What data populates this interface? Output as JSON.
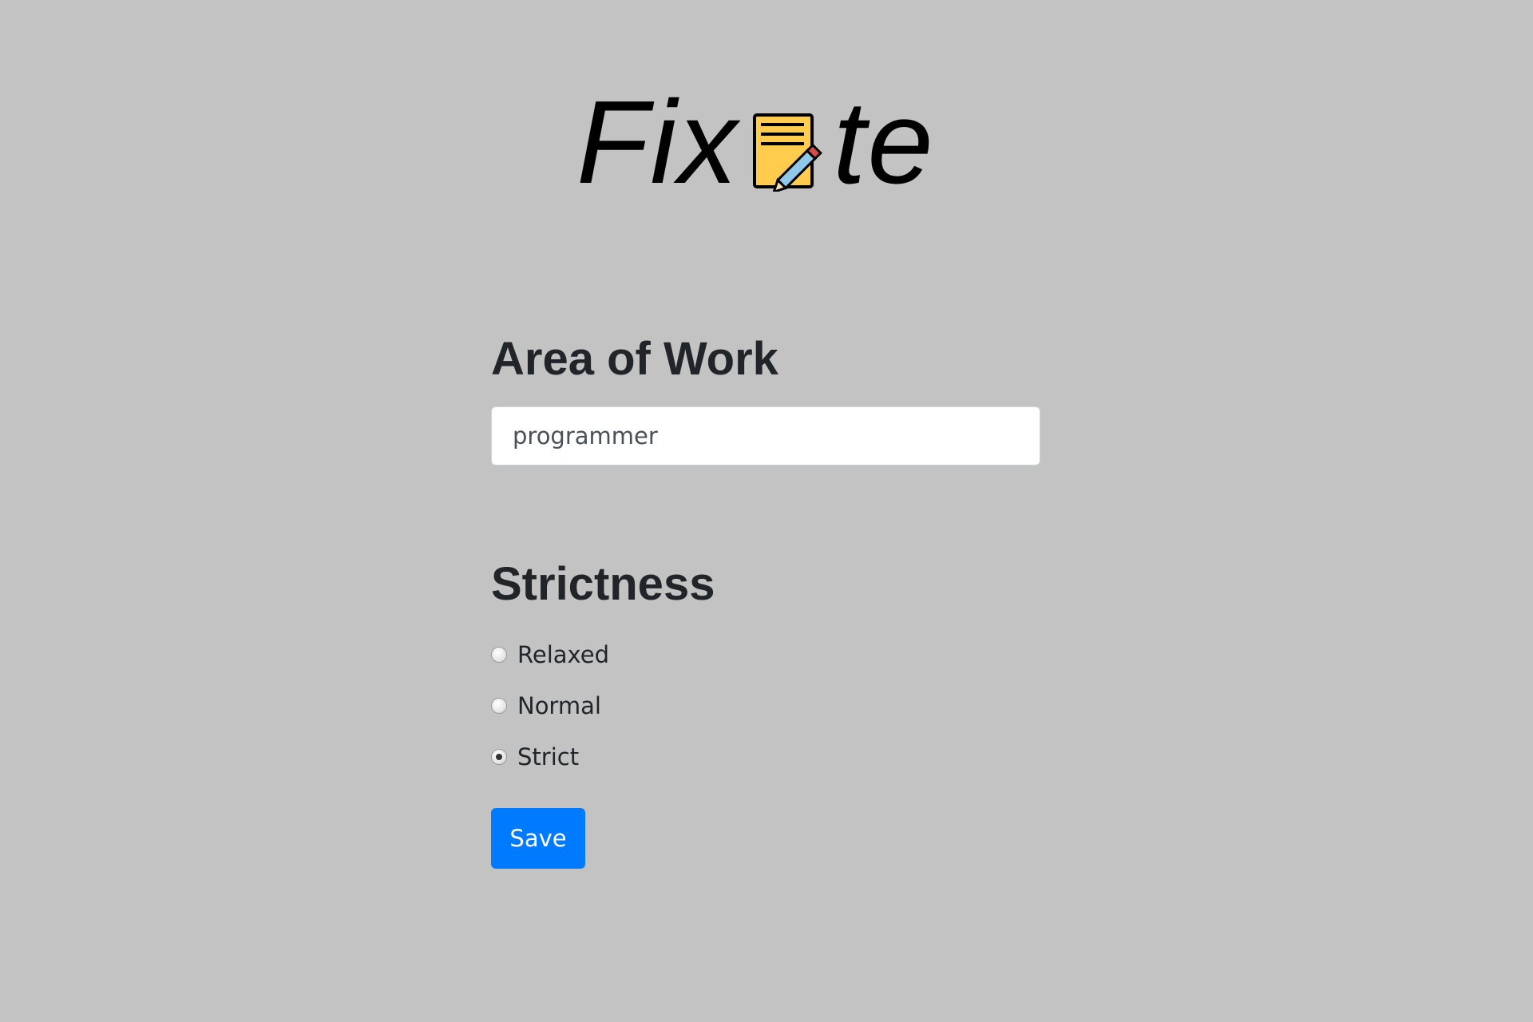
{
  "header": {
    "logo_prefix": "Fix",
    "logo_suffix": "te",
    "logo_icon": "notepad-pencil-icon"
  },
  "area_of_work": {
    "heading": "Area of Work",
    "value": "programmer"
  },
  "strictness": {
    "heading": "Strictness",
    "options": [
      {
        "label": "Relaxed",
        "checked": false
      },
      {
        "label": "Normal",
        "checked": false
      },
      {
        "label": "Strict",
        "checked": true
      }
    ]
  },
  "actions": {
    "save_label": "Save"
  },
  "colors": {
    "background": "#c3c3c3",
    "primary": "#007bff",
    "notepad": "#ffcc4d"
  }
}
